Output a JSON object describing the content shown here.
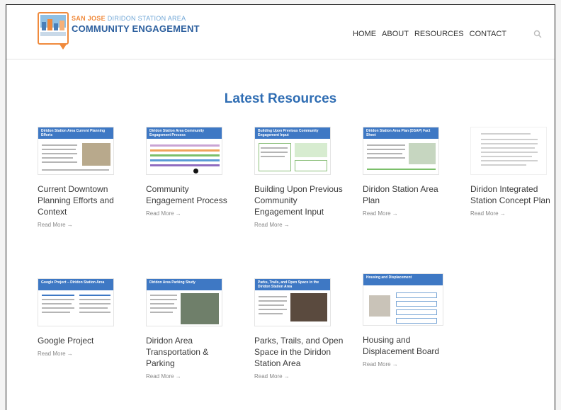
{
  "logo": {
    "line1_bold": "SAN JOSE",
    "line1_light": "DIRIDON STATION AREA",
    "line2": "COMMUNITY ENGAGEMENT"
  },
  "nav": {
    "items": [
      {
        "label": "HOME"
      },
      {
        "label": "ABOUT"
      },
      {
        "label": "RESOURCES"
      },
      {
        "label": "CONTACT"
      }
    ],
    "search_icon": "search-icon"
  },
  "main": {
    "section_title": "Latest Resources",
    "read_more_label": "Read More →",
    "resources": [
      {
        "title": "Current Downtown Planning Efforts and Context",
        "thumb_title": "Diridon Station Area Current Planning Efforts"
      },
      {
        "title": "Community Engagement Process",
        "thumb_title": "Diridon Station Area Community Engagement Process"
      },
      {
        "title": "Building Upon Previous Community Engagement Input",
        "thumb_title": "Building Upon Previous Community Engagement Input"
      },
      {
        "title": "Diridon Station Area Plan",
        "thumb_title": "Diridon Station Area Plan (DSAP) Fact Sheet"
      },
      {
        "title": "Diridon Integrated Station Concept Plan",
        "thumb_title": ""
      },
      {
        "title": "Google Project",
        "thumb_title": "Google Project – Diridon Station Area"
      },
      {
        "title": "Diridon Area Transportation & Parking",
        "thumb_title": "Diridon Area Parking Study"
      },
      {
        "title": "Parks, Trails, and Open Space in the Diridon Station Area",
        "thumb_title": "Parks, Trails, and Open Space in the Diridon Station Area"
      },
      {
        "title": "Housing and Displacement Board",
        "thumb_title": "Housing and Displacement"
      }
    ]
  },
  "colors": {
    "accent_blue": "#2f6db3",
    "logo_orange": "#f08a3c"
  }
}
